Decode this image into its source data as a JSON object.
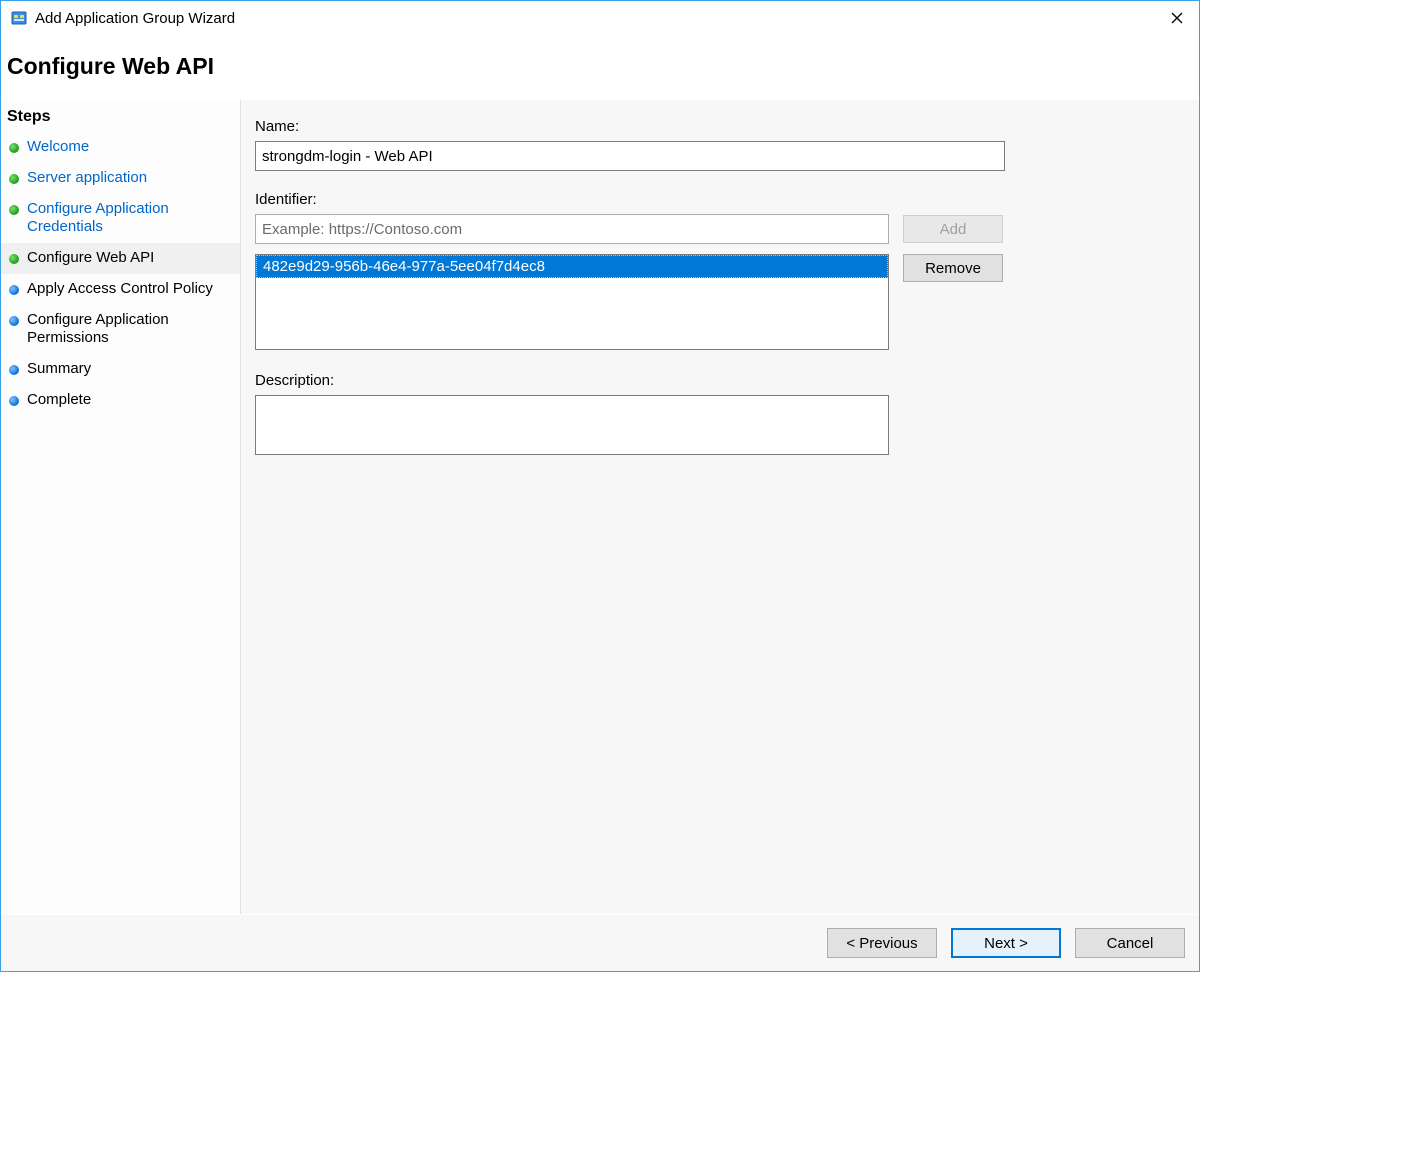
{
  "window": {
    "title": "Add Application Group Wizard"
  },
  "header": {
    "title": "Configure Web API"
  },
  "sidebar": {
    "heading": "Steps",
    "items": [
      {
        "label": "Welcome",
        "state": "done",
        "link": true
      },
      {
        "label": "Server application",
        "state": "done",
        "link": true
      },
      {
        "label": "Configure Application Credentials",
        "state": "done",
        "link": true
      },
      {
        "label": "Configure Web API",
        "state": "done",
        "link": false,
        "current": true
      },
      {
        "label": "Apply Access Control Policy",
        "state": "pending",
        "link": false
      },
      {
        "label": "Configure Application Permissions",
        "state": "pending",
        "link": false
      },
      {
        "label": "Summary",
        "state": "pending",
        "link": false
      },
      {
        "label": "Complete",
        "state": "pending",
        "link": false
      }
    ]
  },
  "form": {
    "name_label": "Name:",
    "name_value": "strongdm-login - Web API",
    "identifier_label": "Identifier:",
    "identifier_placeholder": "Example: https://Contoso.com",
    "identifier_value": "",
    "add_label": "Add",
    "remove_label": "Remove",
    "identifier_list": [
      "482e9d29-956b-46e4-977a-5ee04f7d4ec8"
    ],
    "description_label": "Description:",
    "description_value": ""
  },
  "footer": {
    "previous": "< Previous",
    "next": "Next >",
    "cancel": "Cancel"
  }
}
